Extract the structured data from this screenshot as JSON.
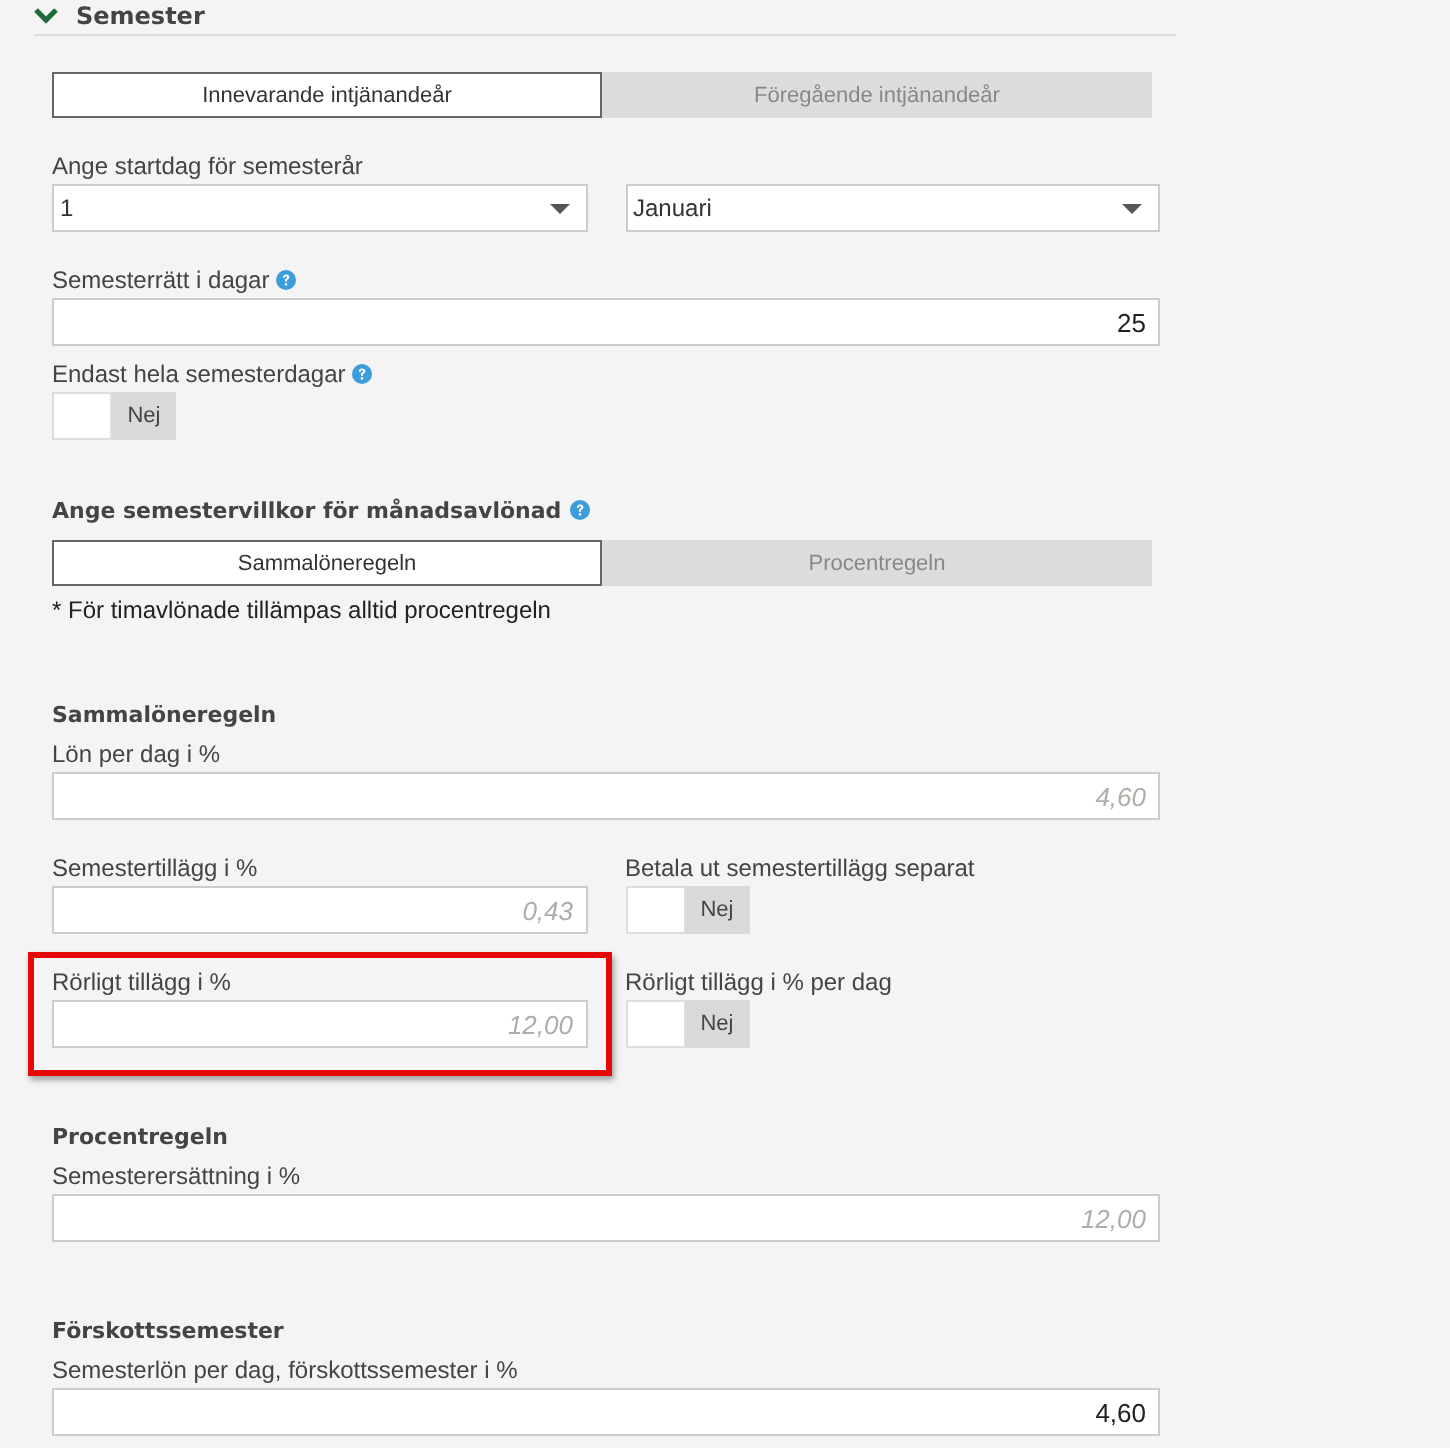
{
  "section": {
    "title": "Semester",
    "expanded": true
  },
  "items": [
    {
      "kind": "tabs",
      "tabs": [
        {
          "label": "Innevarande intjänandeår",
          "selected": true
        },
        {
          "label": "Föregående intjänandeår",
          "selected": false
        }
      ]
    },
    {
      "kind": "selects",
      "label": "Ange startdag för semesterår",
      "selects": [
        {
          "value": "1"
        },
        {
          "value": "Januari"
        }
      ]
    },
    {
      "kind": "field",
      "label": "Semesterrätt i dagar",
      "help": true,
      "value": "25"
    },
    {
      "kind": "toggle",
      "label": "Endast hela semesterdagar",
      "help": true,
      "toggle": {
        "label": "Nej",
        "on": false
      }
    },
    {
      "kind": "heading",
      "text": "Ange semestervillkor för månadsavlönad",
      "help": true
    },
    {
      "kind": "tabs",
      "tabs": [
        {
          "label": "Sammalöneregeln",
          "selected": true
        },
        {
          "label": "Procentregeln",
          "selected": false
        }
      ]
    },
    {
      "kind": "note",
      "text": "* För timavlönade tillämpas alltid procentregeln"
    },
    {
      "kind": "heading",
      "text": "Sammalöneregeln"
    },
    {
      "kind": "field",
      "label": "Lön per dag i %",
      "placeholder": "4,60"
    },
    {
      "kind": "row",
      "cells": [
        {
          "kind": "field",
          "label": "Semestertillägg i %",
          "placeholder": "0,43"
        },
        {
          "kind": "toggle",
          "label": "Betala ut semestertillägg separat",
          "toggle": {
            "label": "Nej",
            "on": false
          }
        }
      ]
    },
    {
      "kind": "row",
      "cells": [
        {
          "kind": "field",
          "label": "Rörligt tillägg i %",
          "placeholder": "12,00",
          "highlighted": true
        },
        {
          "kind": "toggle",
          "label": "Rörligt tillägg i % per dag",
          "toggle": {
            "label": "Nej",
            "on": false
          }
        }
      ]
    },
    {
      "kind": "heading",
      "text": "Procentregeln"
    },
    {
      "kind": "field",
      "label": "Semesterersättning i %",
      "placeholder": "12,00"
    },
    {
      "kind": "heading",
      "text": "Förskottssemester"
    },
    {
      "kind": "field",
      "label": "Semesterlön per dag, förskottssemester i %",
      "value": "4,60"
    }
  ]
}
